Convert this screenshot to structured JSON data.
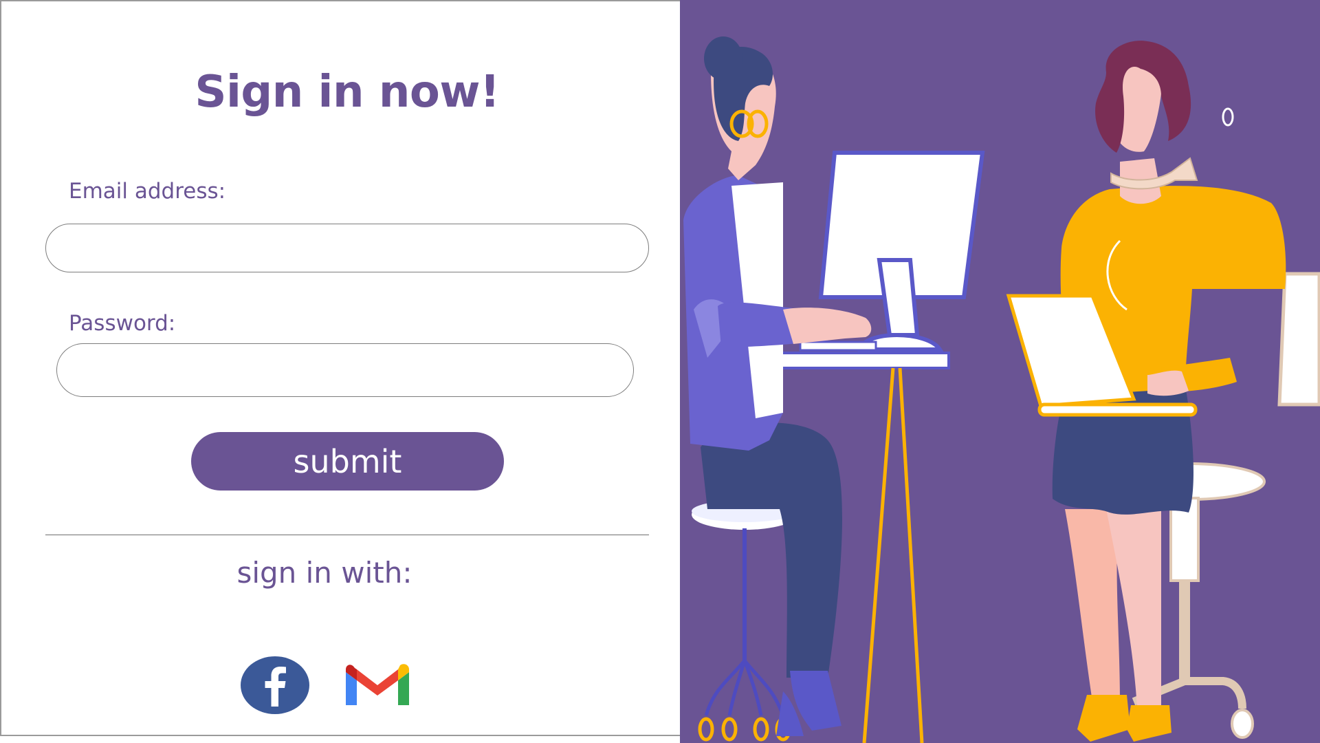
{
  "form": {
    "title": "Sign in now!",
    "email": {
      "label": "Email address:",
      "value": "",
      "placeholder": ""
    },
    "password": {
      "label": "Password:",
      "value": "",
      "placeholder": ""
    },
    "submit_label": "submit",
    "signin_with_label": "sign in with:",
    "social_icons": [
      "facebook-icon",
      "gmail-icon"
    ]
  },
  "colors": {
    "accent": "#6a5494",
    "illustration_bg": "#6a5494",
    "facebook_blue": "#3b5998",
    "yellow": "#fbb203",
    "navy": "#3d4a80",
    "periwinkle": "#6a63cf"
  }
}
